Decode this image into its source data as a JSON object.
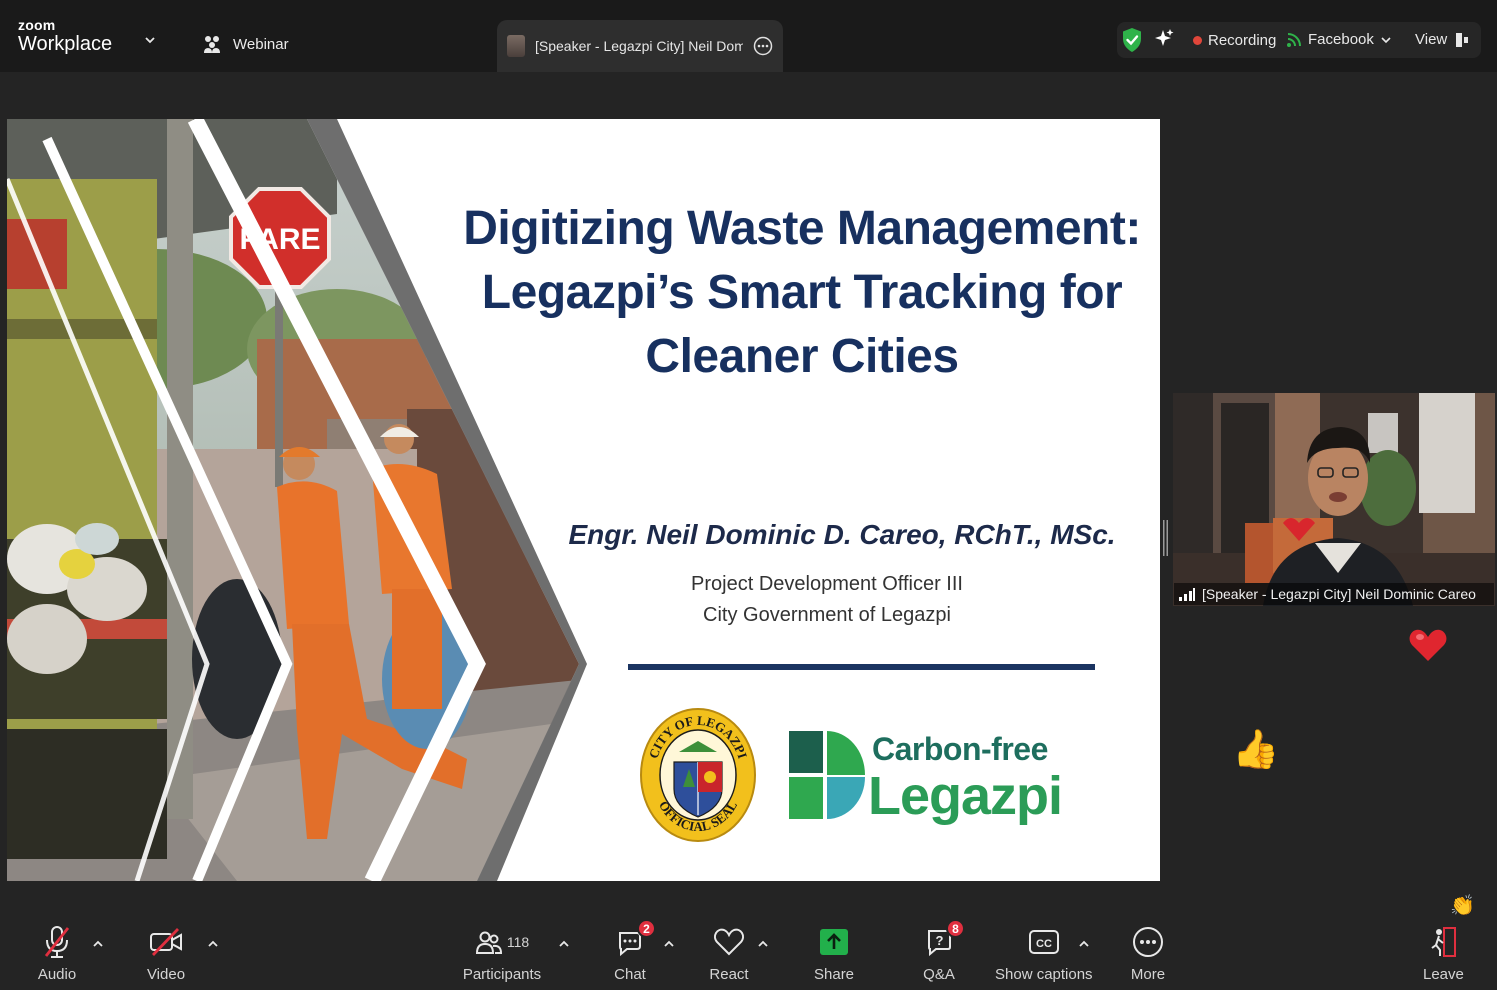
{
  "header": {
    "brand_small": "zoom",
    "brand_big": "Workplace",
    "webinar_label": "Webinar",
    "tab_title": "[Speaker - Legazpi City] Neil Dom",
    "recording_label": "Recording",
    "stream_label": "Facebook",
    "view_label": "View"
  },
  "slide": {
    "title": "Digitizing Waste Management: Legazpi’s Smart Tracking for Cleaner Cities",
    "presenter": "Engr. Neil Dominic D. Careo, RChT., MSc.",
    "role_line1": "Project Development Officer III",
    "role_line2": "City Government of Legazpi",
    "sign_text": "PARE",
    "seal_top": "CITY OF LEGAZPI",
    "seal_bottom": "OFFICIAL SEAL",
    "logo_top": "Carbon-free",
    "logo_bottom": "Legazpi"
  },
  "video": {
    "name": "[Speaker - Legazpi City] Neil Dominic Careo"
  },
  "reactions": {
    "thumbs": "👍",
    "clap": "👏"
  },
  "toolbar": {
    "audio": "Audio",
    "video": "Video",
    "participants": "Participants",
    "participants_count": "118",
    "chat": "Chat",
    "chat_badge": "2",
    "react": "React",
    "share": "Share",
    "qa": "Q&A",
    "qa_badge": "8",
    "captions": "Show captions",
    "captions_icon": "CC",
    "more": "More",
    "leave": "Leave"
  },
  "colors": {
    "background": "#242424",
    "topbar": "#1a1a1a",
    "slide_title": "#17305f",
    "share_green": "#22b04b",
    "badge_red": "#e02f3f",
    "recording_red": "#e0463a",
    "shield_green": "#2fb34a"
  }
}
